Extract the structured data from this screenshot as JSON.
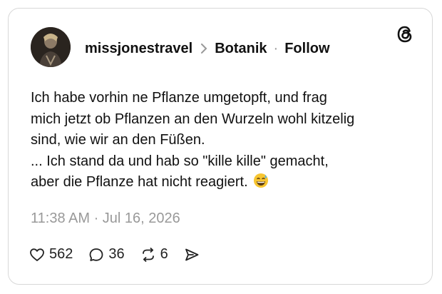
{
  "post": {
    "username": "missjonestravel",
    "community": "Botanik",
    "follow_label": "Follow",
    "text_lines": [
      "Ich habe vorhin ne Pflanze umgetopft, und frag",
      "mich jetzt ob Pflanzen an den Wurzeln wohl kitzelig",
      "sind, wie wir an den Füßen.",
      "... Ich stand da und hab so \"kille kille\" gemacht,",
      "aber die Pflanze hat nicht reagiert."
    ],
    "emoji": "😅",
    "timestamp": "11:38 AM · Jul 16, 2026"
  },
  "actions": {
    "likes": "562",
    "replies": "36",
    "reposts": "6"
  },
  "icons": {
    "logo": "threads-logo-icon",
    "like": "heart-icon",
    "reply": "speech-bubble-icon",
    "repost": "repost-icon",
    "share": "send-icon"
  }
}
